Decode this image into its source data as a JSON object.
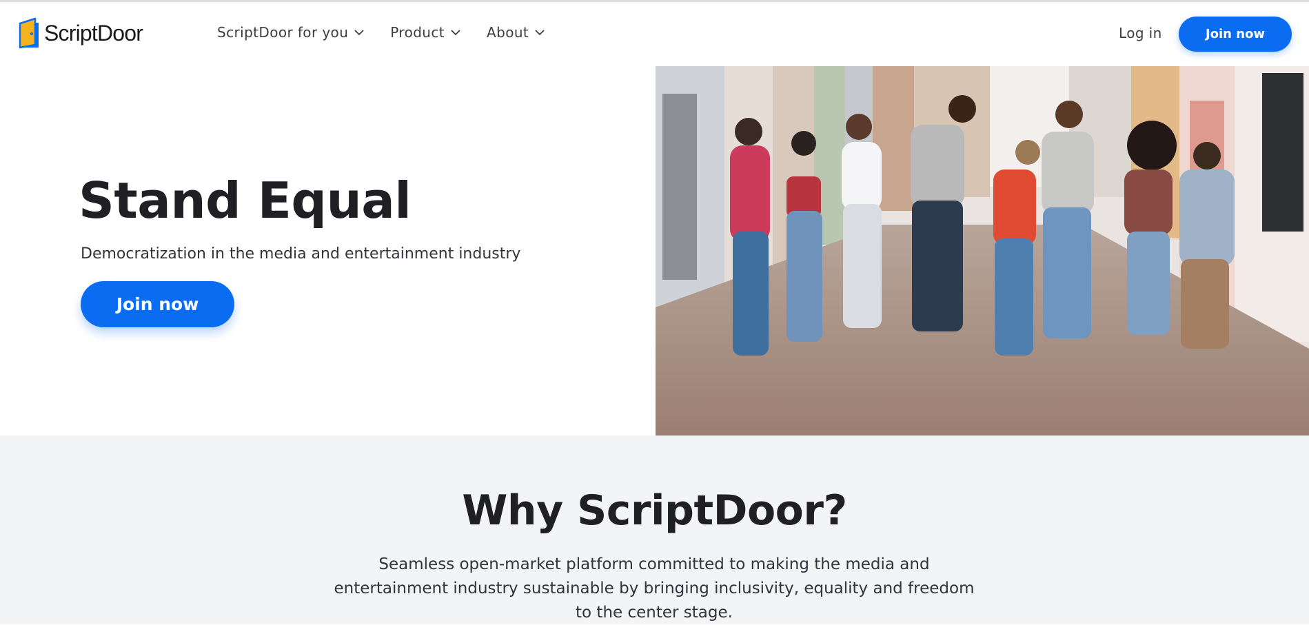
{
  "brand": {
    "name": "ScriptDoor",
    "logo_icon": "door-icon"
  },
  "nav": {
    "items": [
      {
        "label": "ScriptDoor for you",
        "icon": "chevron-down-icon"
      },
      {
        "label": "Product",
        "icon": "chevron-down-icon"
      },
      {
        "label": "About",
        "icon": "chevron-down-icon"
      }
    ],
    "login_label": "Log in",
    "join_label": "Join now"
  },
  "hero": {
    "title": "Stand Equal",
    "subtitle": "Democratization in the media and entertainment industry",
    "cta_label": "Join now"
  },
  "why": {
    "title": "Why ScriptDoor?",
    "text": "Seamless open-market platform committed to making the media and entertainment industry sustainable by bringing inclusivity, equality and freedom to the center stage."
  },
  "colors": {
    "accent": "#0a6cf1",
    "logo_yellow": "#f4b31c",
    "text_dark": "#1f1f24",
    "section_bg": "#f3f4f6"
  }
}
